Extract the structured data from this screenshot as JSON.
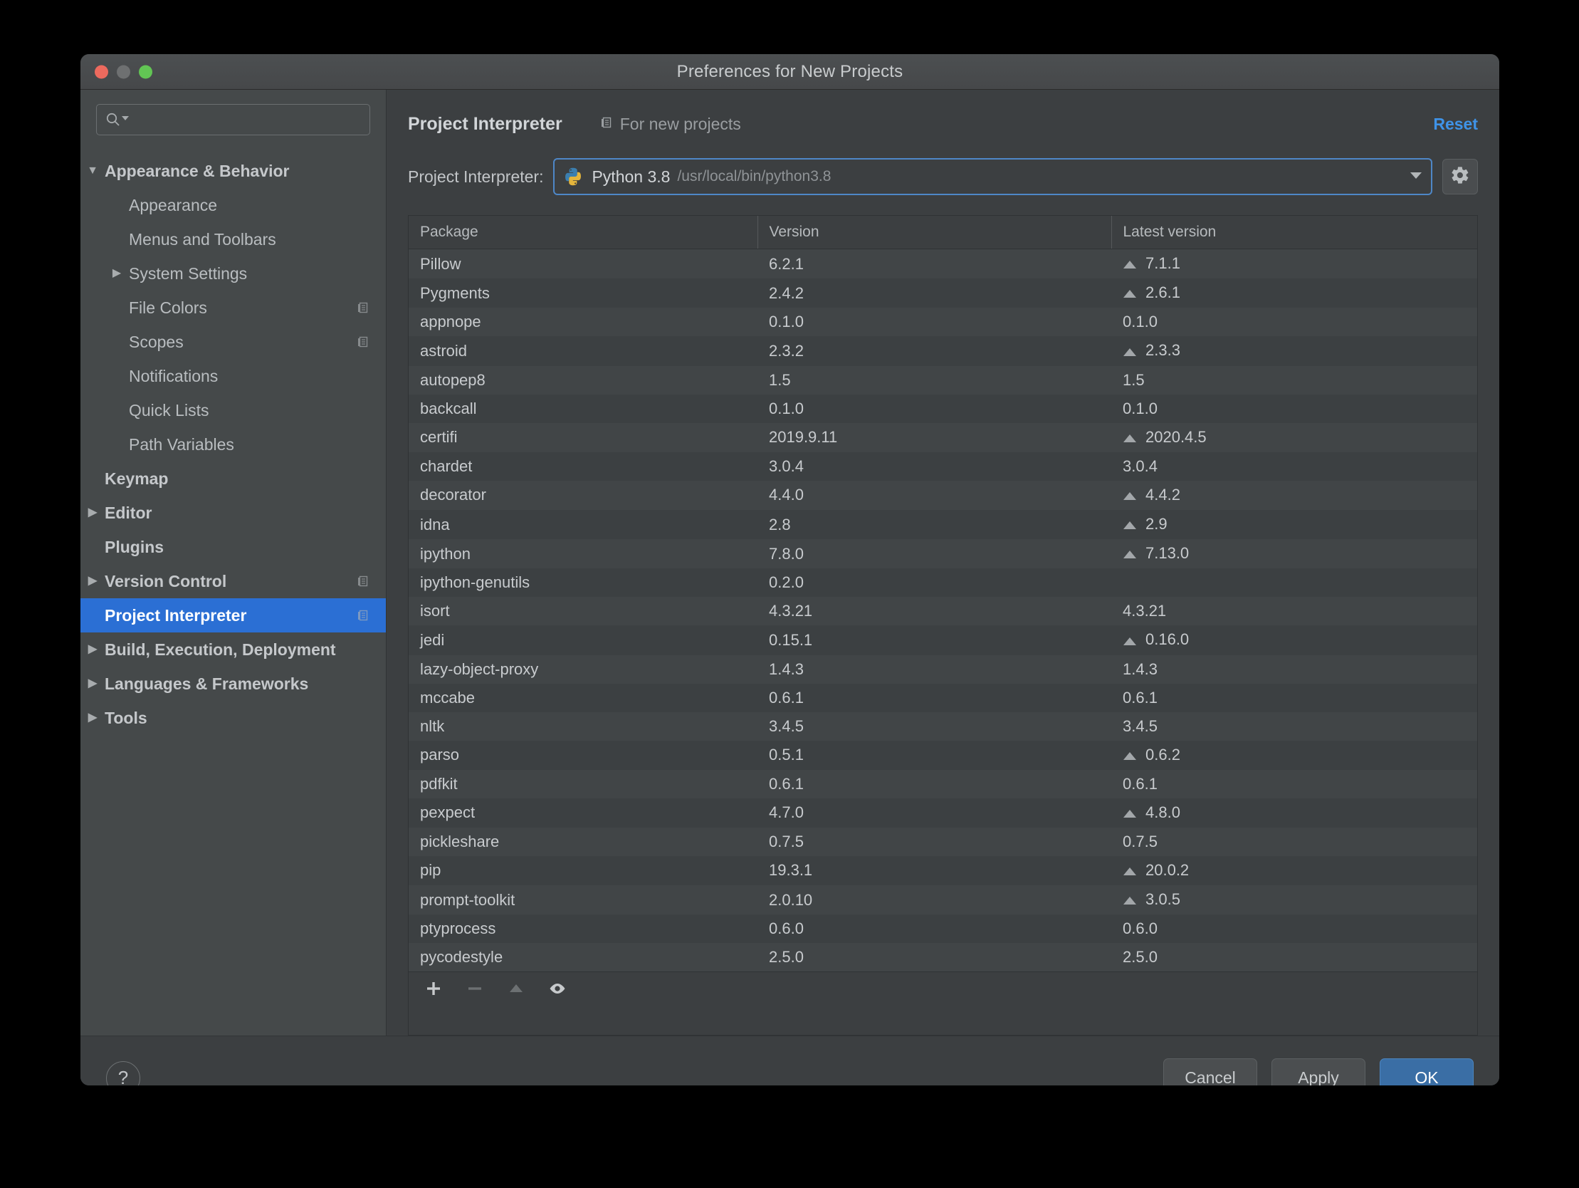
{
  "window": {
    "title": "Preferences for New Projects",
    "traffic_lights": [
      "close-button",
      "minimize-button",
      "zoom-button"
    ]
  },
  "sidebar": {
    "search": {
      "value": "",
      "placeholder": ""
    },
    "items": [
      {
        "label": "Appearance & Behavior",
        "level": "top",
        "twisty": "▼",
        "bold": true,
        "selected": false,
        "copy": false
      },
      {
        "label": "Appearance",
        "level": "child",
        "twisty": "",
        "bold": false,
        "selected": false,
        "copy": false
      },
      {
        "label": "Menus and Toolbars",
        "level": "child",
        "twisty": "",
        "bold": false,
        "selected": false,
        "copy": false
      },
      {
        "label": "System Settings",
        "level": "child",
        "twisty": "▶",
        "bold": false,
        "selected": false,
        "copy": false
      },
      {
        "label": "File Colors",
        "level": "child",
        "twisty": "",
        "bold": false,
        "selected": false,
        "copy": true
      },
      {
        "label": "Scopes",
        "level": "child",
        "twisty": "",
        "bold": false,
        "selected": false,
        "copy": true
      },
      {
        "label": "Notifications",
        "level": "child",
        "twisty": "",
        "bold": false,
        "selected": false,
        "copy": false
      },
      {
        "label": "Quick Lists",
        "level": "child",
        "twisty": "",
        "bold": false,
        "selected": false,
        "copy": false
      },
      {
        "label": "Path Variables",
        "level": "child",
        "twisty": "",
        "bold": false,
        "selected": false,
        "copy": false
      },
      {
        "label": "Keymap",
        "level": "top",
        "twisty": "",
        "bold": true,
        "selected": false,
        "copy": false
      },
      {
        "label": "Editor",
        "level": "top",
        "twisty": "▶",
        "bold": true,
        "selected": false,
        "copy": false
      },
      {
        "label": "Plugins",
        "level": "top",
        "twisty": "",
        "bold": true,
        "selected": false,
        "copy": false
      },
      {
        "label": "Version Control",
        "level": "top",
        "twisty": "▶",
        "bold": true,
        "selected": false,
        "copy": true
      },
      {
        "label": "Project Interpreter",
        "level": "top",
        "twisty": "",
        "bold": true,
        "selected": true,
        "copy": true
      },
      {
        "label": "Build, Execution, Deployment",
        "level": "top",
        "twisty": "▶",
        "bold": true,
        "selected": false,
        "copy": false
      },
      {
        "label": "Languages & Frameworks",
        "level": "top",
        "twisty": "▶",
        "bold": true,
        "selected": false,
        "copy": false
      },
      {
        "label": "Tools",
        "level": "top",
        "twisty": "▶",
        "bold": true,
        "selected": false,
        "copy": false
      }
    ]
  },
  "main": {
    "title": "Project Interpreter",
    "scope_label": "For new projects",
    "reset_label": "Reset",
    "interpreter": {
      "field_label": "Project Interpreter:",
      "name": "Python 3.8",
      "path": "/usr/local/bin/python3.8",
      "icon": "python-icon",
      "caret": "chevron-down-icon",
      "settings_icon": "gear-icon"
    },
    "table": {
      "columns": [
        "Package",
        "Version",
        "Latest version"
      ],
      "rows": [
        {
          "package": "Pillow",
          "version": "6.2.1",
          "latest": "7.1.1",
          "upgradable": true
        },
        {
          "package": "Pygments",
          "version": "2.4.2",
          "latest": "2.6.1",
          "upgradable": true
        },
        {
          "package": "appnope",
          "version": "0.1.0",
          "latest": "0.1.0",
          "upgradable": false
        },
        {
          "package": "astroid",
          "version": "2.3.2",
          "latest": "2.3.3",
          "upgradable": true
        },
        {
          "package": "autopep8",
          "version": "1.5",
          "latest": "1.5",
          "upgradable": false
        },
        {
          "package": "backcall",
          "version": "0.1.0",
          "latest": "0.1.0",
          "upgradable": false
        },
        {
          "package": "certifi",
          "version": "2019.9.11",
          "latest": "2020.4.5",
          "upgradable": true
        },
        {
          "package": "chardet",
          "version": "3.0.4",
          "latest": "3.0.4",
          "upgradable": false
        },
        {
          "package": "decorator",
          "version": "4.4.0",
          "latest": "4.4.2",
          "upgradable": true
        },
        {
          "package": "idna",
          "version": "2.8",
          "latest": "2.9",
          "upgradable": true
        },
        {
          "package": "ipython",
          "version": "7.8.0",
          "latest": "7.13.0",
          "upgradable": true
        },
        {
          "package": "ipython-genutils",
          "version": "0.2.0",
          "latest": "",
          "upgradable": false
        },
        {
          "package": "isort",
          "version": "4.3.21",
          "latest": "4.3.21",
          "upgradable": false
        },
        {
          "package": "jedi",
          "version": "0.15.1",
          "latest": "0.16.0",
          "upgradable": true
        },
        {
          "package": "lazy-object-proxy",
          "version": "1.4.3",
          "latest": "1.4.3",
          "upgradable": false
        },
        {
          "package": "mccabe",
          "version": "0.6.1",
          "latest": "0.6.1",
          "upgradable": false
        },
        {
          "package": "nltk",
          "version": "3.4.5",
          "latest": "3.4.5",
          "upgradable": false
        },
        {
          "package": "parso",
          "version": "0.5.1",
          "latest": "0.6.2",
          "upgradable": true
        },
        {
          "package": "pdfkit",
          "version": "0.6.1",
          "latest": "0.6.1",
          "upgradable": false
        },
        {
          "package": "pexpect",
          "version": "4.7.0",
          "latest": "4.8.0",
          "upgradable": true
        },
        {
          "package": "pickleshare",
          "version": "0.7.5",
          "latest": "0.7.5",
          "upgradable": false
        },
        {
          "package": "pip",
          "version": "19.3.1",
          "latest": "20.0.2",
          "upgradable": true
        },
        {
          "package": "prompt-toolkit",
          "version": "2.0.10",
          "latest": "3.0.5",
          "upgradable": true
        },
        {
          "package": "ptyprocess",
          "version": "0.6.0",
          "latest": "0.6.0",
          "upgradable": false
        },
        {
          "package": "pycodestyle",
          "version": "2.5.0",
          "latest": "2.5.0",
          "upgradable": false
        }
      ],
      "toolbar": [
        {
          "name": "add-package-button",
          "glyph": "plus-icon",
          "enabled": true
        },
        {
          "name": "remove-package-button",
          "glyph": "minus-icon",
          "enabled": false
        },
        {
          "name": "upgrade-package-button",
          "glyph": "up-arrow-icon",
          "enabled": false
        },
        {
          "name": "show-early-releases-button",
          "glyph": "eye-icon",
          "enabled": true
        }
      ]
    }
  },
  "footer": {
    "help_label": "?",
    "cancel_label": "Cancel",
    "apply_label": "Apply",
    "ok_label": "OK"
  },
  "colors": {
    "accent_blue": "#2b6fd4",
    "link_blue": "#3f93e8",
    "ok_button": "#3a6ea5",
    "window_bg": "#3c3f41",
    "sidebar_bg": "#45494a"
  }
}
